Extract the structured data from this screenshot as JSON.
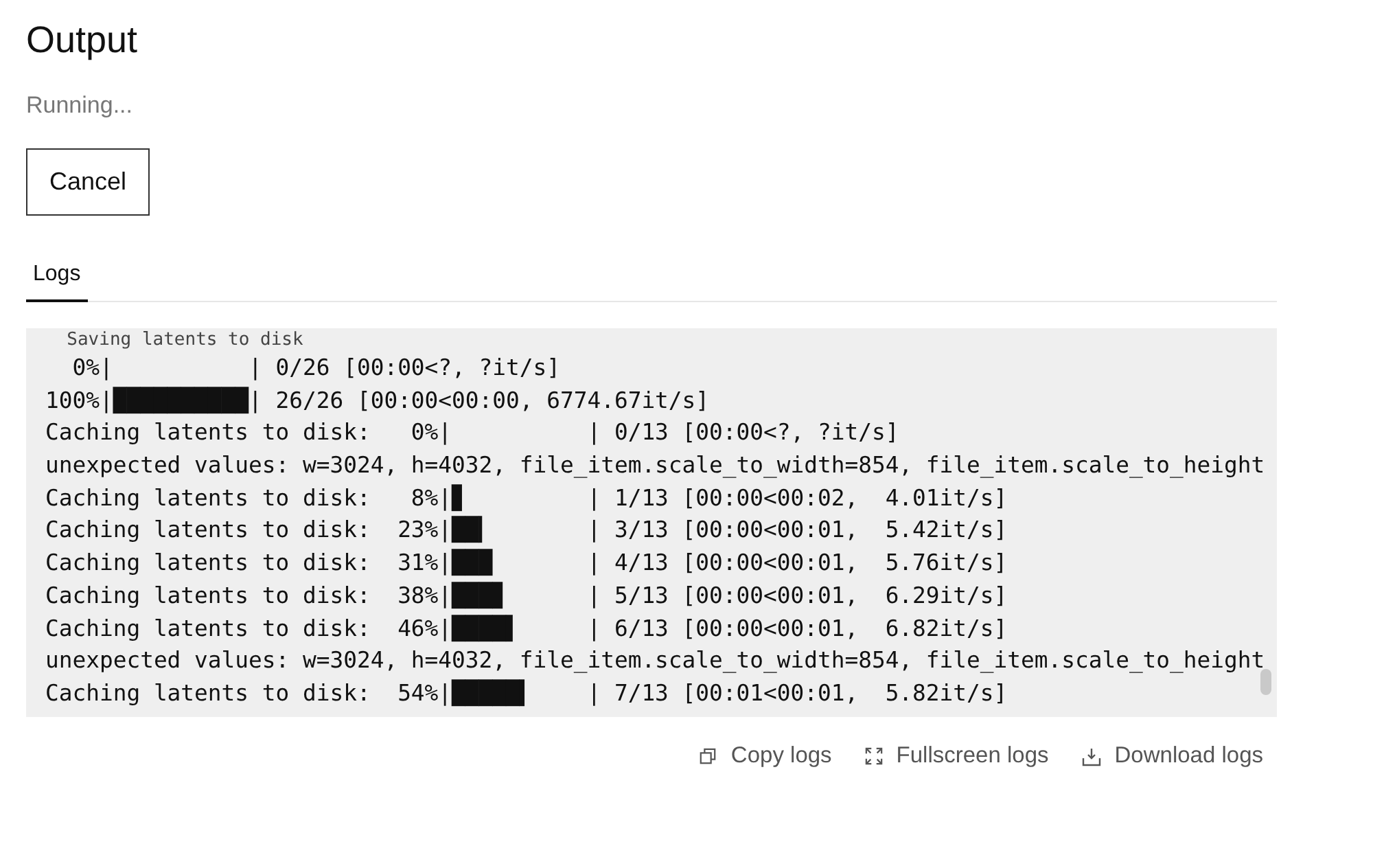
{
  "title": "Output",
  "status": "Running...",
  "cancel_button": "Cancel",
  "tabs": [
    {
      "label": "Logs",
      "selected": true
    }
  ],
  "log_lines": [
    "  Saving latents to disk",
    "  0%|          | 0/26 [00:00<?, ?it/s]",
    "100%|██████████| 26/26 [00:00<00:00, 6774.67it/s]",
    "Caching latents to disk:   0%|          | 0/13 [00:00<?, ?it/s]",
    "unexpected values: w=3024, h=4032, file_item.scale_to_width=854, file_item.scale_to_height",
    "Caching latents to disk:   8%|▊         | 1/13 [00:00<00:02,  4.01it/s]",
    "Caching latents to disk:  23%|██▎       | 3/13 [00:00<00:01,  5.42it/s]",
    "Caching latents to disk:  31%|███       | 4/13 [00:00<00:01,  5.76it/s]",
    "Caching latents to disk:  38%|███▊      | 5/13 [00:00<00:01,  6.29it/s]",
    "Caching latents to disk:  46%|████▌     | 6/13 [00:00<00:01,  6.82it/s]",
    "unexpected values: w=3024, h=4032, file_item.scale_to_width=854, file_item.scale_to_height",
    "Caching latents to disk:  54%|█████▍    | 7/13 [00:01<00:01,  5.82it/s]"
  ],
  "actions": [
    {
      "kind": "copy",
      "label": "Copy logs"
    },
    {
      "kind": "fullscreen",
      "label": "Fullscreen logs"
    },
    {
      "kind": "download",
      "label": "Download logs"
    }
  ]
}
